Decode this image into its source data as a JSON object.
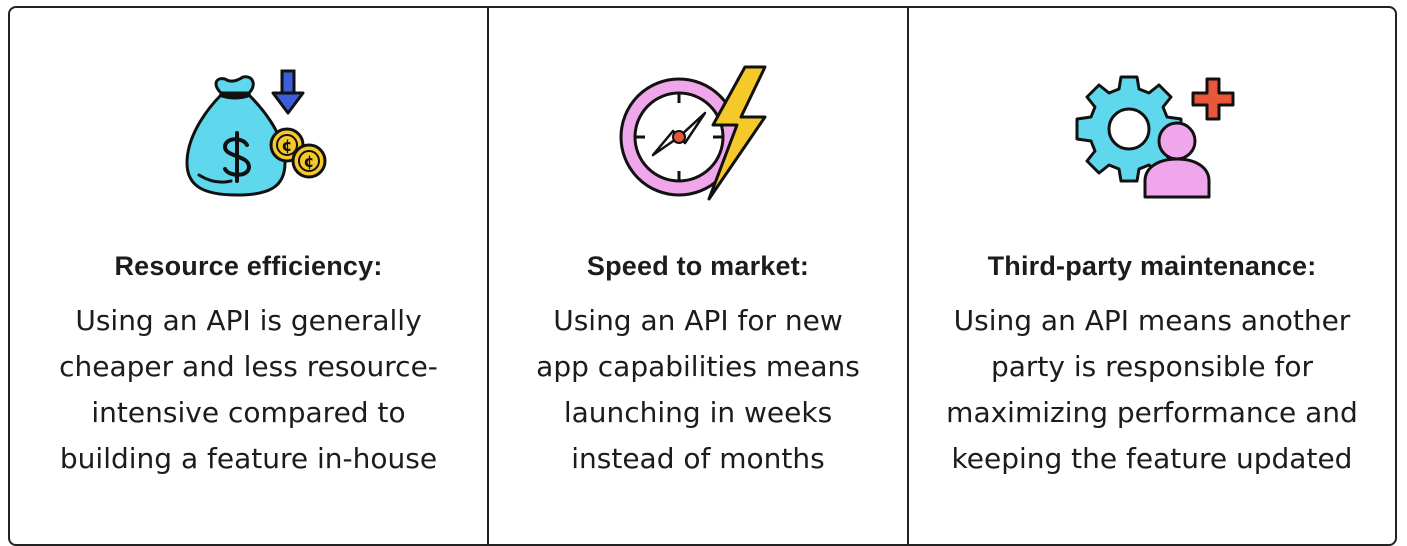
{
  "cards": [
    {
      "icon": "money-bag-icon",
      "title": "Resource efficiency:",
      "lines": [
        "Using an API is generally",
        "cheaper and less resource-",
        "intensive compared to",
        "building a feature in-house"
      ]
    },
    {
      "icon": "compass-lightning-icon",
      "title": "Speed to market:",
      "lines": [
        "Using an API for new",
        "app capabilities means",
        "launching in weeks",
        "instead of months"
      ]
    },
    {
      "icon": "gear-person-plus-icon",
      "title": "Third-party maintenance:",
      "lines": [
        "Using an API means another",
        "party is responsible for",
        "maximizing performance and",
        "keeping the feature updated"
      ]
    }
  ],
  "colors": {
    "border": "#222222",
    "cyan": "#5fd8ee",
    "blue": "#3a5fd9",
    "yellow": "#f6c92a",
    "pink": "#f0a6ea",
    "orange": "#e9573b"
  }
}
